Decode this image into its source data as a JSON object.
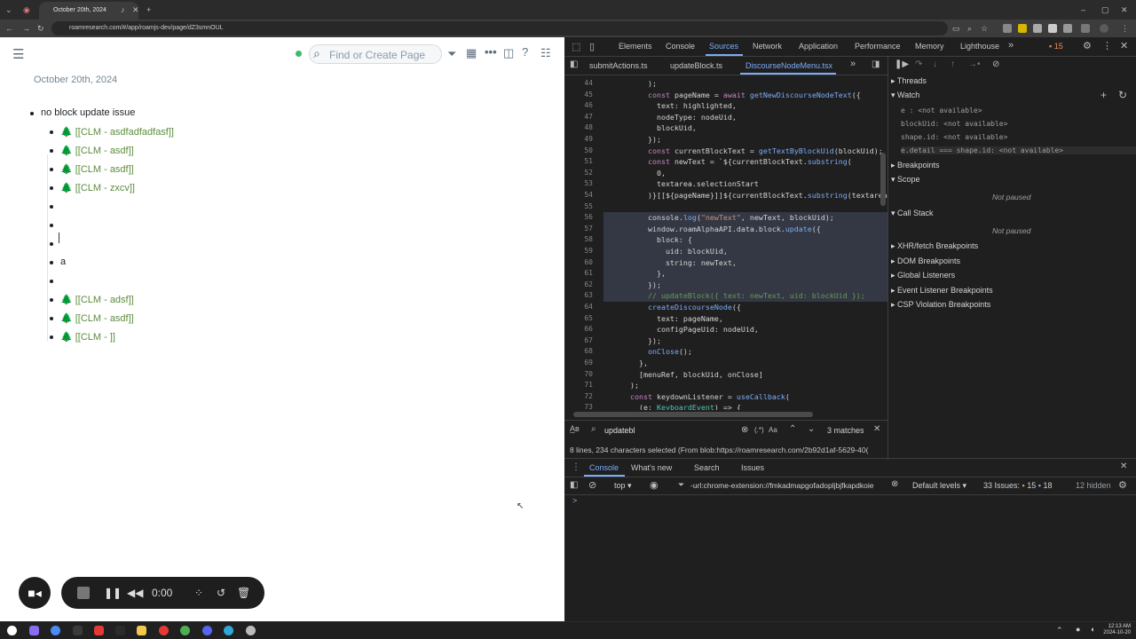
{
  "browser": {
    "tab_title": "October 20th, 2024",
    "url": "roamresearch.com/#/app/roamjs-dev/page/dZ3smnOUL"
  },
  "roam": {
    "search_placeholder": "Find or Create Page",
    "page_title": "October 20th, 2024",
    "blocks": [
      {
        "text": "no block update issue",
        "level": 0,
        "ref": false
      },
      {
        "text": "[[CLM - asdfadfadfasf]]",
        "level": 1,
        "ref": true
      },
      {
        "text": "[[CLM - asdf]]",
        "level": 1,
        "ref": true
      },
      {
        "text": "[[CLM - asdf]]",
        "level": 1,
        "ref": true
      },
      {
        "text": "[[CLM - zxcv]]",
        "level": 1,
        "ref": true
      },
      {
        "text": "",
        "level": 1,
        "ref": false
      },
      {
        "text": "",
        "level": 1,
        "ref": false
      },
      {
        "text": "",
        "level": 1,
        "ref": false
      },
      {
        "text": "a",
        "level": 1,
        "ref": false
      },
      {
        "text": "",
        "level": 1,
        "ref": false
      },
      {
        "text": "[[CLM - adsf]]",
        "level": 1,
        "ref": true
      },
      {
        "text": "[[CLM - asdf]]",
        "level": 1,
        "ref": true
      },
      {
        "text": "[[CLM - ]]",
        "level": 1,
        "ref": true
      }
    ]
  },
  "recorder": {
    "time": "0:00"
  },
  "devtools": {
    "tabs": [
      "Elements",
      "Console",
      "Sources",
      "Network",
      "Application",
      "Performance",
      "Memory",
      "Lighthouse"
    ],
    "active_tab": "Sources",
    "issue_count": "15",
    "file_tabs": [
      "submitActions.ts",
      "updateBlock.ts",
      "DiscourseNodeMenu.tsx"
    ],
    "active_file": "DiscourseNodeMenu.tsx",
    "code_lines": [
      {
        "n": "44",
        "t": "        );"
      },
      {
        "n": "45",
        "t": "        const pageName = await getNewDiscourseNodeText({"
      },
      {
        "n": "46",
        "t": "          text: highlighted,"
      },
      {
        "n": "47",
        "t": "          nodeType: nodeUid,"
      },
      {
        "n": "48",
        "t": "          blockUid,"
      },
      {
        "n": "49",
        "t": "        });"
      },
      {
        "n": "50",
        "t": "        const currentBlockText = getTextByBlockUid(blockUid);"
      },
      {
        "n": "51",
        "t": "        const newText = `${currentBlockText.substring("
      },
      {
        "n": "52",
        "t": "          0,"
      },
      {
        "n": "53",
        "t": "          textarea.selectionStart"
      },
      {
        "n": "54",
        "t": "        )}[[${pageName}]]${currentBlockText.substring(textarea.se"
      },
      {
        "n": "55",
        "t": ""
      },
      {
        "n": "56",
        "t": "        console.log(\"newText\", newText, blockUid);"
      },
      {
        "n": "57",
        "t": "        window.roamAlphaAPI.data.block.update({"
      },
      {
        "n": "58",
        "t": "          block: {"
      },
      {
        "n": "59",
        "t": "            uid: blockUid,"
      },
      {
        "n": "60",
        "t": "            string: newText,"
      },
      {
        "n": "61",
        "t": "          },"
      },
      {
        "n": "62",
        "t": "        });"
      },
      {
        "n": "63",
        "t": "        // updateBlock({ text: newText, uid: blockUid });"
      },
      {
        "n": "64",
        "t": "        createDiscourseNode({"
      },
      {
        "n": "65",
        "t": "          text: pageName,"
      },
      {
        "n": "66",
        "t": "          configPageUid: nodeUid,"
      },
      {
        "n": "67",
        "t": "        });"
      },
      {
        "n": "68",
        "t": "        onClose();"
      },
      {
        "n": "69",
        "t": "      },"
      },
      {
        "n": "70",
        "t": "      [menuRef, blockUid, onClose]"
      },
      {
        "n": "71",
        "t": "    );"
      },
      {
        "n": "72",
        "t": "    const keydownListener = useCallback("
      },
      {
        "n": "73",
        "t": "      (e: KeyboardEvent) => {"
      }
    ],
    "debugger": {
      "threads": "Threads",
      "watch": "Watch",
      "watch_items": [
        "e  : <not available>",
        "blockUid: <not available>",
        "shape.id: <not available>",
        "e.detail === shape.id: <not available>"
      ],
      "breakpoints": "Breakpoints",
      "scope": "Scope",
      "not_paused": "Not paused",
      "call_stack": "Call Stack",
      "not_paused_2": "Not paused",
      "other": [
        "XHR/fetch Breakpoints",
        "DOM Breakpoints",
        "Global Listeners",
        "Event Listener Breakpoints",
        "CSP Violation Breakpoints"
      ]
    },
    "find": {
      "query": "updatebl",
      "matches": "3 matches",
      "regex": "(.*)",
      "case": "Aa"
    },
    "status": "8 lines, 234 characters selected  (From blob:https://roamresearch.com/2b92d1af-5629-40(",
    "drawer_tabs": [
      "Console",
      "What's new",
      "Search",
      "Issues"
    ],
    "console": {
      "context": "top",
      "filter": "-url:chrome-extension://fmkadmapgofadopljbjfkapdkoie",
      "levels": "Default levels",
      "issues": "33 Issues:",
      "warn_count": "15",
      "info_count": "18",
      "hidden": "12 hidden",
      "prompt": ">"
    }
  },
  "taskbar": {
    "time": "12:13 AM",
    "date": "2024-10-20"
  }
}
